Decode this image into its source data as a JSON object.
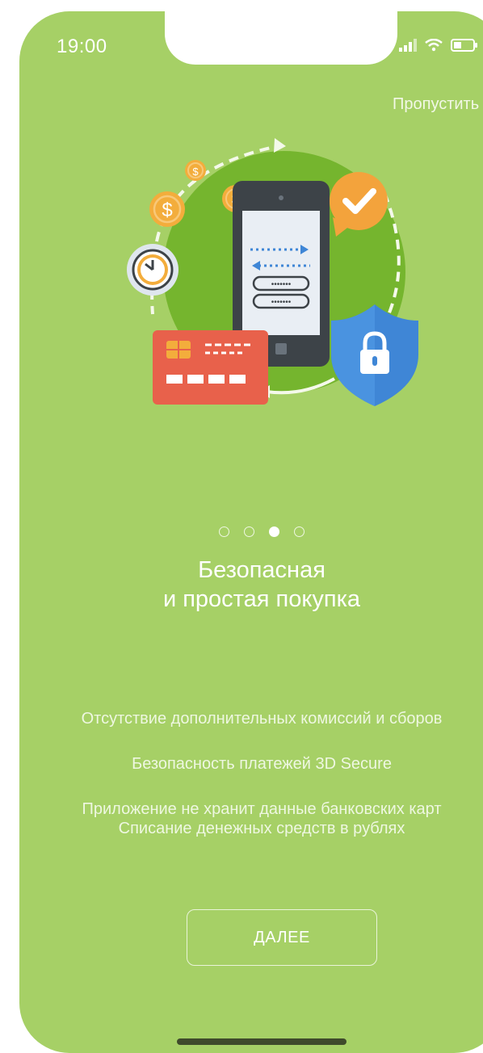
{
  "status_bar": {
    "time": "19:00",
    "icons": [
      "signal-icon",
      "wifi-icon",
      "battery-icon"
    ]
  },
  "header": {
    "skip_label": "Пропустить"
  },
  "illustration": {
    "name": "secure-payment-illustration",
    "elements": [
      "coin-icon",
      "clock-icon",
      "phone-icon",
      "checkmark-badge-icon",
      "credit-card-icon",
      "shield-lock-icon"
    ]
  },
  "pager": {
    "count": 4,
    "active_index": 2
  },
  "title": {
    "line1": "Безопасная",
    "line2": "и простая покупка"
  },
  "features": [
    "Отсутствие дополнительных комиссий и сборов",
    "Безопасность платежей 3D Secure",
    "Приложение не хранит данные банковских карт",
    "Списание денежных средств в рублях"
  ],
  "actions": {
    "next_label": "ДАЛЕЕ"
  },
  "colors": {
    "background": "#a6d066",
    "illustration_circle": "#75b52e",
    "coin": "#f3ad3c",
    "check_badge": "#f3a33c",
    "card": "#e8614b",
    "shield": "#3f86d6",
    "phone_body": "#3d4348",
    "phone_screen": "#e9eef4"
  }
}
